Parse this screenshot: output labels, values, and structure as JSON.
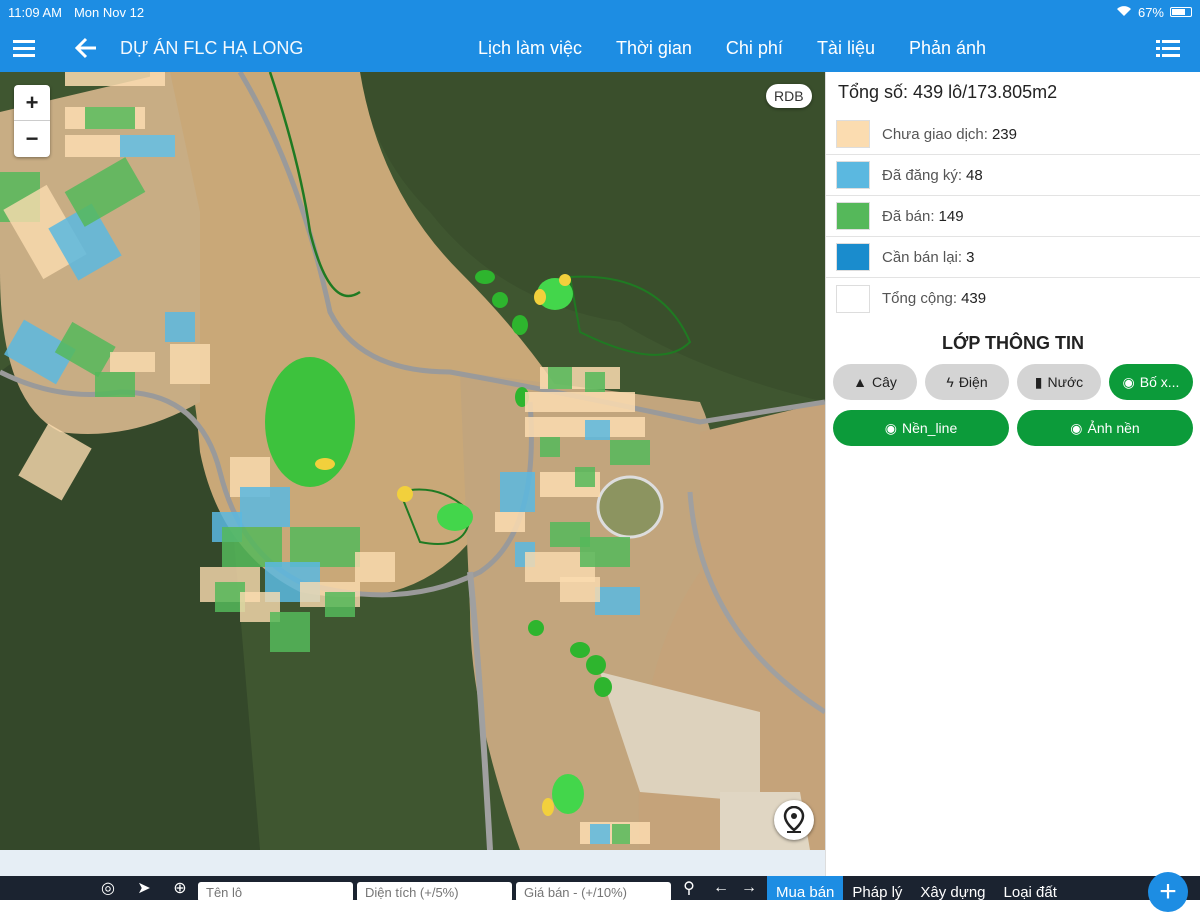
{
  "statusbar": {
    "time": "11:09 AM",
    "date": "Mon Nov 12",
    "battery": "67%"
  },
  "appbar": {
    "title": "DỰ ÁN FLC HẠ LONG",
    "nav": [
      "Lịch làm việc",
      "Thời gian",
      "Chi phí",
      "Tài liệu",
      "Phản ánh"
    ]
  },
  "map": {
    "zoom_in": "+",
    "zoom_out": "−",
    "rdb_label": "RDB"
  },
  "panel": {
    "total": "Tổng số: 439 lô/173.805m2",
    "legend": [
      {
        "label": "Chưa giao dịch:",
        "count": "239",
        "color": "#fbdcb0"
      },
      {
        "label": "Đã đăng ký:",
        "count": "48",
        "color": "#5bb8e0"
      },
      {
        "label": "Đã bán:",
        "count": "149",
        "color": "#55b85a"
      },
      {
        "label": "Cần bán lại:",
        "count": "3",
        "color": "#1a8ccd"
      },
      {
        "label": "Tổng cộng:",
        "count": "439",
        "color": "#ffffff"
      }
    ],
    "layer_title": "LỚP THÔNG TIN",
    "buttons_row1": [
      "Cây",
      "Điện",
      "Nước",
      "Bố x..."
    ],
    "buttons_row2": [
      "Nền_line",
      "Ảnh nền"
    ]
  },
  "bottombar": {
    "placeholders": [
      "Tên lô",
      "Diện tích (+/5%)",
      "Giá bán - (+/10%)"
    ],
    "tabs": [
      "Mua bán",
      "Pháp lý",
      "Xây dựng",
      "Loại đất"
    ],
    "active_tab": "Mua bán"
  }
}
